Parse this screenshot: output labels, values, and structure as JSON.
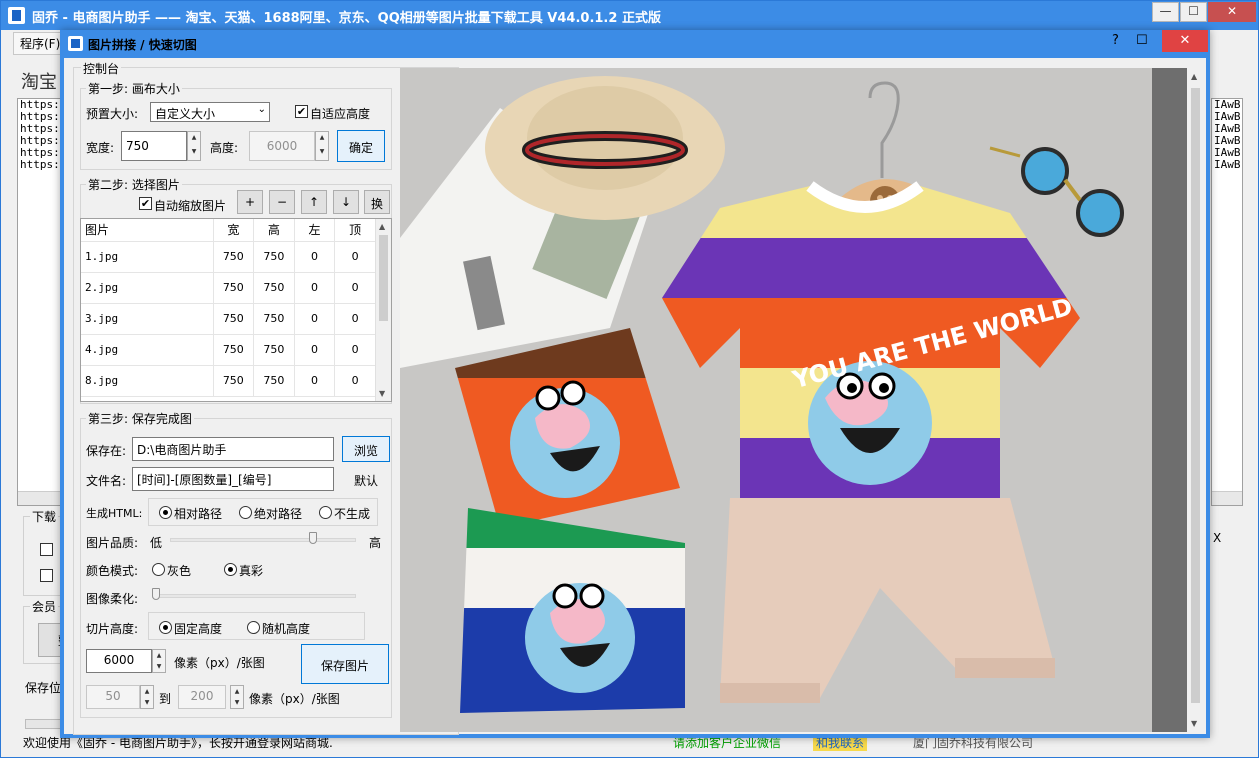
{
  "main_window": {
    "title": "固乔 - 电商图片助手 —— 淘宝、天猫、1688阿里、京东、QQ相册等图片批量下载工具 V44.0.1.2 正式版",
    "menu_program": "程序(F)",
    "taobao_label": "淘宝",
    "url_lines": [
      "https://",
      "https://",
      "https://",
      "https://",
      "https://",
      "https://"
    ],
    "right_lines": [
      "IAwB",
      "IAwB",
      "IAwB",
      "IAwB",
      "IAwB",
      "IAwB"
    ],
    "right_x": "X",
    "download_group_label": "下载",
    "member_group_label": "会员",
    "member_button_label": "整",
    "save_position_label": "保存位",
    "status_welcome": "欢迎使用《固乔 - 电商图片助手》，长按开通登录网站商城.",
    "status_green": "请添加客户企业微信",
    "status_contact": "和我联系",
    "status_company": "厦门固乔科技有限公司",
    "min_symbol": "—",
    "max_symbol": "☐",
    "close_symbol": "✕",
    "colors": {
      "titlebar": "#3c8ce6",
      "close": "#c75050",
      "accent": "#0078d7"
    }
  },
  "dialog": {
    "title": "图片拼接 / 快速切图",
    "help_symbol": "?",
    "max_symbol": "☐",
    "close_symbol": "✕",
    "console_label": "控制台",
    "step1": {
      "label": "第一步: 画布大小",
      "preset_label": "预置大小:",
      "preset_value": "自定义大小",
      "auto_height_label": "自适应高度",
      "auto_height_checked": true,
      "width_label": "宽度:",
      "width_value": "750",
      "height_label": "高度:",
      "height_value": "6000",
      "confirm_button": "确定"
    },
    "step2": {
      "label": "第二步: 选择图片",
      "auto_scale_label": "自动缩放图片",
      "auto_scale_checked": true,
      "buttons": [
        "+",
        "−",
        "↑",
        "↓",
        "换"
      ],
      "columns": [
        "图片",
        "宽",
        "高",
        "左",
        "顶"
      ],
      "rows": [
        [
          "1.jpg",
          "750",
          "750",
          "0",
          "0"
        ],
        [
          "2.jpg",
          "750",
          "750",
          "0",
          "0"
        ],
        [
          "3.jpg",
          "750",
          "750",
          "0",
          "0"
        ],
        [
          "4.jpg",
          "750",
          "750",
          "0",
          "0"
        ],
        [
          "8.jpg",
          "750",
          "750",
          "0",
          "0"
        ]
      ]
    },
    "step3": {
      "label": "第三步: 保存完成图",
      "save_to_label": "保存在:",
      "save_to_value": "D:\\电商图片助手",
      "browse_button": "浏览",
      "filename_label": "文件名:",
      "filename_value": "[时间]-[原图数量]_[编号]",
      "default_link": "默认",
      "html_label": "生成HTML:",
      "html_options": [
        "相对路径",
        "绝对路径",
        "不生成"
      ],
      "html_selected": 0,
      "quality_label": "图片品质:",
      "quality_low": "低",
      "quality_high": "高",
      "quality_level": 0.78,
      "color_mode_label": "颜色模式:",
      "color_options": [
        "灰色",
        "真彩"
      ],
      "color_selected": 1,
      "soften_label": "图像柔化:",
      "soften_level": 0,
      "slice_height_label": "切片高度:",
      "slice_options": [
        "固定高度",
        "随机高度"
      ],
      "slice_selected": 0,
      "fixed_height_value": "6000",
      "unit_label": "像素（px）/张图",
      "save_button": "保存图片",
      "random_min": "50",
      "to_label": "到",
      "random_max": "200",
      "unit_label2": "像素（px）/张图"
    },
    "preview": {
      "kid_shirt_text": "YOU ARE THE WORLD"
    }
  }
}
